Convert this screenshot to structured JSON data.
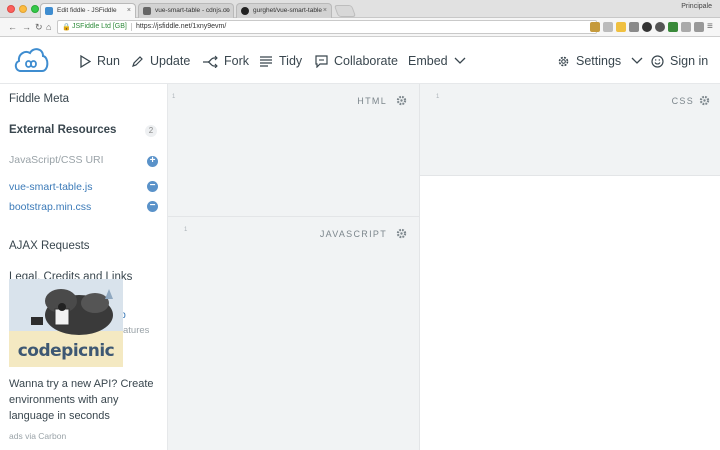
{
  "browser": {
    "tabs": [
      {
        "title": "Edit fiddle - JSFiddle",
        "favicon_color": "#3f8dd0"
      },
      {
        "title": "vue-smart-table - cdnjs.co",
        "favicon_color": "#666666"
      },
      {
        "title": "gurghet/vue-smart-table",
        "favicon_color": "#222222"
      }
    ],
    "profile_name": "Principale",
    "secure_label": "JSFiddle Ltd [GB]",
    "url": "https://jsfiddle.net/1xny9evm/"
  },
  "header": {
    "run_label": "Run",
    "update_label": "Update",
    "fork_label": "Fork",
    "tidy_label": "Tidy",
    "collaborate_label": "Collaborate",
    "embed_label": "Embed",
    "settings_label": "Settings",
    "signin_label": "Sign in"
  },
  "sidebar": {
    "fiddle_meta": "Fiddle Meta",
    "external_resources": "External Resources",
    "resource_count": "2",
    "uri_placeholder": "JavaScript/CSS URI",
    "resources": [
      "vue-smart-table.js",
      "bootstrap.min.css"
    ],
    "ajax_requests": "AJAX Requests",
    "legal": "Legal, Credits and Links"
  },
  "ad": {
    "brand": "codepicnic",
    "overlap_link": "p",
    "overlap_sub": "atures",
    "text": "Wanna try a new API? Create environments with any language in seconds",
    "via": "ads via Carbon"
  },
  "panels": {
    "html_label": "HTML",
    "css_label": "CSS",
    "js_label": "JAVASCRIPT",
    "line_number": "1"
  },
  "colors": {
    "accent": "#3f8dd0",
    "link": "#3b7ab8",
    "panel_bg": "#f1f3f4",
    "text": "#39464e"
  }
}
